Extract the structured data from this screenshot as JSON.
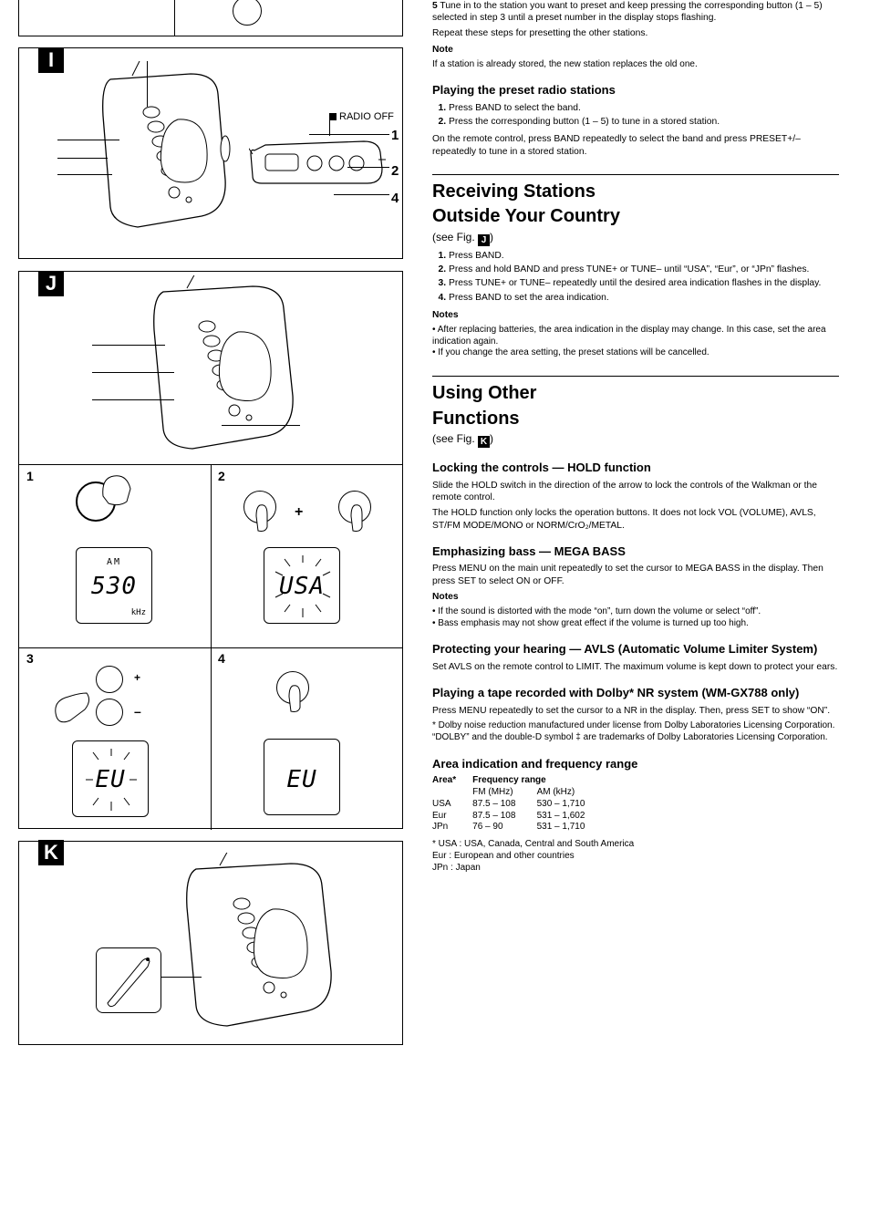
{
  "figI": {
    "tag": "I",
    "radio_off_label": "RADIO OFF",
    "callouts": {
      "n1": "1",
      "n2": "2",
      "n4": "4"
    }
  },
  "figJ": {
    "tag": "J",
    "cells": {
      "c1": {
        "num": "1",
        "lcd_am": "AM",
        "lcd_val": "530",
        "lcd_khz": "kHz"
      },
      "c2": {
        "num": "2",
        "lcd_val": "USA"
      },
      "c3": {
        "num": "3",
        "lcd_val": "EU"
      },
      "c4": {
        "num": "4",
        "lcd_val": "EU"
      }
    }
  },
  "figK": {
    "tag": "K"
  },
  "right": {
    "intro_num": "5",
    "intro": "Tune in to the station you want to preset and keep pressing the corresponding button (1 – 5) selected in step 3 until a preset number in the display stops flashing.",
    "intro2": "Repeat these steps for presetting the other stations.",
    "noteHead": "Note",
    "note": "If a station is already stored, the new station replaces the old one.",
    "play_title": "Playing the preset radio stations",
    "play_steps": {
      "s1": "Press BAND to select the band.",
      "s2": "Press the corresponding button (1 – 5) to tune in a stored station."
    },
    "play_remote": "On the remote control, press BAND repeatedly to select the band and press PRESET+/– repeatedly to tune in a stored station.",
    "recv_h1": "Receiving Stations",
    "recv_h2": "Outside Your Country",
    "areaSteps": {
      "s1": "Press BAND.",
      "s2": "Press and hold BAND and press TUNE+ or TUNE– until “USA”, “Eur”, or “JPn” flashes.",
      "s3": "Press TUNE+ or TUNE– repeatedly until the desired area indication flashes in the display.",
      "s4": "Press BAND to set the area indication."
    },
    "areaNote1": "After replacing batteries, the area indication in the display may change. In this case, set the area indication again.",
    "areaNote2": "If you change the area setting, the preset stations will be cancelled.",
    "addi_h1": "Using Other",
    "addi_h2": "Functions",
    "addi_ref": "K",
    "lock_title": "Locking the controls — HOLD function",
    "lock_body": "Slide the HOLD switch in the direction of the arrow to lock the controls of the Walkman or the remote control.",
    "lock_body2": "The HOLD function only locks the operation buttons. It does not lock VOL (VOLUME), AVLS, ST/FM MODE/MONO or NORM/CrO₂/METAL.",
    "emph_title": "Emphasizing bass — MEGA BASS",
    "emph_body": "Press MENU on the main unit repeatedly to set the cursor to MEGA BASS in the display. Then press SET to select ON or OFF.",
    "emph_note_head": "Notes",
    "emph_notes": [
      "If the sound is distorted with the mode “on”, turn down the volume or select “off”.",
      "Bass emphasis may not show great effect if the volume is turned up too high."
    ],
    "ears_title": "Protecting your hearing — AVLS (Automatic Volume Limiter System)",
    "ears_body": "Set AVLS on the remote control to LIMIT. The maximum volume is kept down to protect your ears.",
    "tape_title": "Playing a tape recorded with Dolby* NR system (WM-GX788 only)",
    "tape_body": "Press MENU repeatedly to set the cursor to a NR in the display. Then, press SET to show “ON”.",
    "tape_foot": "* Dolby noise reduction manufactured under license from Dolby Laboratories Licensing Corporation.\n“DOLBY” and the double-D symbol ‡ are trademarks of Dolby Laboratories Licensing Corporation.",
    "area_table_title": "Area indication and frequency range",
    "area_table": {
      "headers": [
        "Area*",
        "Frequency range",
        ""
      ],
      "subhead": [
        "",
        "FM (MHz)",
        "AM (kHz)"
      ],
      "rows": [
        [
          "USA",
          "87.5 – 108",
          "530 – 1,710"
        ],
        [
          "Eur",
          "87.5 – 108",
          "531 – 1,602"
        ],
        [
          "JPn",
          "76 – 90",
          "531 – 1,710"
        ]
      ],
      "foot": "* USA : USA, Canada, Central and South America\n  Eur  : European and other countries\n  JPn  : Japan"
    }
  }
}
